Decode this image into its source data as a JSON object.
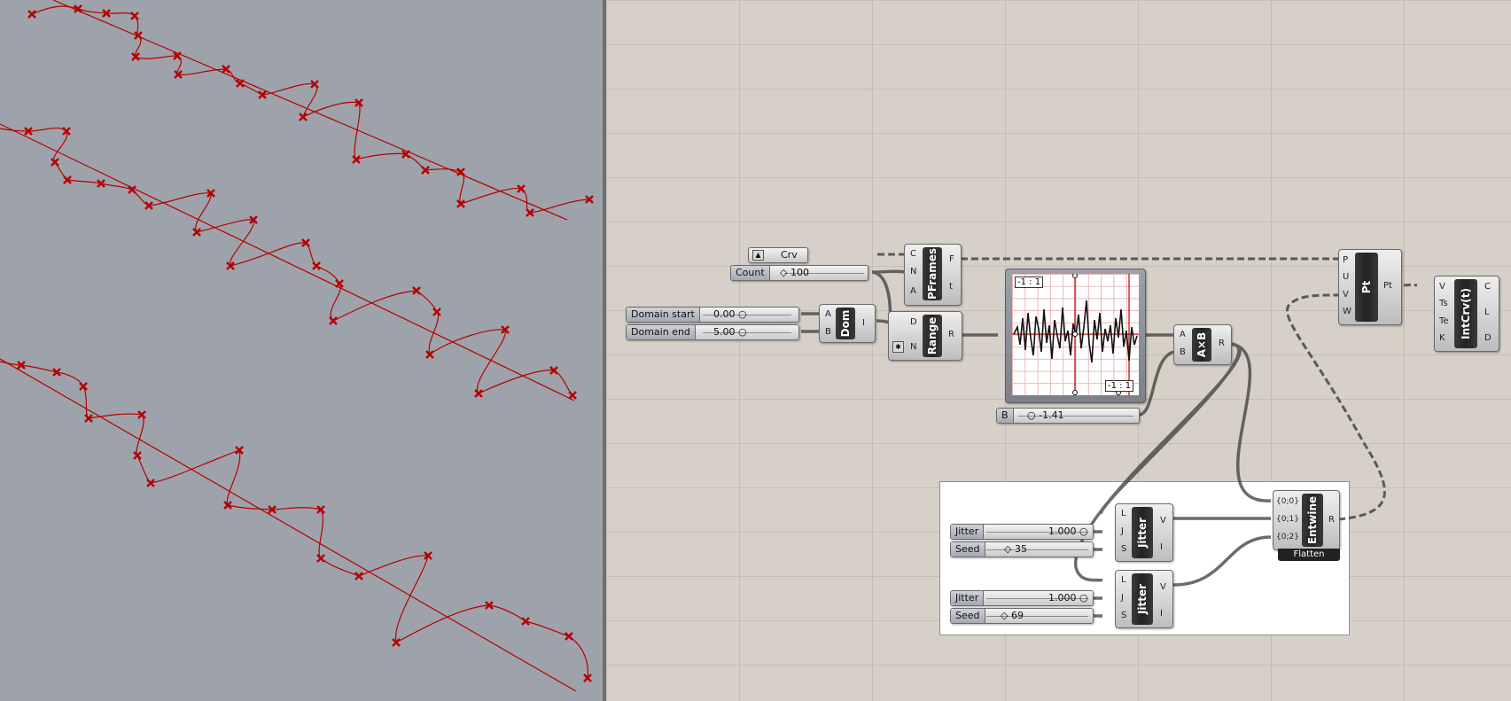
{
  "viewport": {
    "background": "#9ea3ab",
    "curve_color": "#b50000"
  },
  "canvas": {
    "background": "#d6d0c8",
    "crv_param": {
      "label": "Crv"
    },
    "count_slider": {
      "label": "Count",
      "value": "100"
    },
    "domain_start": {
      "label": "Domain start",
      "value": "0.00"
    },
    "domain_end": {
      "label": "Domain end",
      "value": "5.00"
    },
    "b_slider": {
      "label": "B",
      "value": "-1.41"
    },
    "graph": {
      "label_top": "-1 : 1",
      "label_bottom": "-1 : 1"
    },
    "components": {
      "pframes": {
        "name": "PFrames",
        "inputs": [
          "C",
          "N",
          "A"
        ],
        "outputs": [
          "F",
          "t"
        ]
      },
      "dom": {
        "name": "Dom",
        "inputs": [
          "A",
          "B"
        ],
        "outputs": [
          "I"
        ]
      },
      "range": {
        "name": "Range",
        "inputs": [
          "D",
          "N"
        ],
        "outputs": [
          "R"
        ]
      },
      "mult": {
        "name": "A×B",
        "inputs": [
          "A",
          "B"
        ],
        "outputs": [
          "R"
        ]
      },
      "pt": {
        "name": "Pt",
        "inputs": [
          "P",
          "U",
          "V",
          "W"
        ],
        "outputs": [
          "Pt"
        ]
      },
      "intcrv": {
        "name": "IntCrv(t)",
        "inputs": [
          "V",
          "Ts",
          "Te",
          "K"
        ],
        "outputs": [
          "C",
          "L",
          "D"
        ]
      },
      "jitter1": {
        "name": "Jitter",
        "inputs": [
          "L",
          "J",
          "S"
        ],
        "outputs": [
          "V",
          "I"
        ]
      },
      "jitter2": {
        "name": "Jitter",
        "inputs": [
          "L",
          "J",
          "S"
        ],
        "outputs": [
          "V",
          "I"
        ]
      },
      "entwine": {
        "name": "Entwine",
        "inputs": [
          "{0;0}",
          "{0;1}",
          "{0;2}"
        ],
        "outputs": [
          "R"
        ],
        "flag": "Flatten"
      }
    },
    "jitter1_slider": {
      "label": "Jitter",
      "value": "1.000"
    },
    "seed1_slider": {
      "label": "Seed",
      "value": "35"
    },
    "jitter2_slider": {
      "label": "Jitter",
      "value": "1.000"
    },
    "seed2_slider": {
      "label": "Seed",
      "value": "69"
    }
  }
}
